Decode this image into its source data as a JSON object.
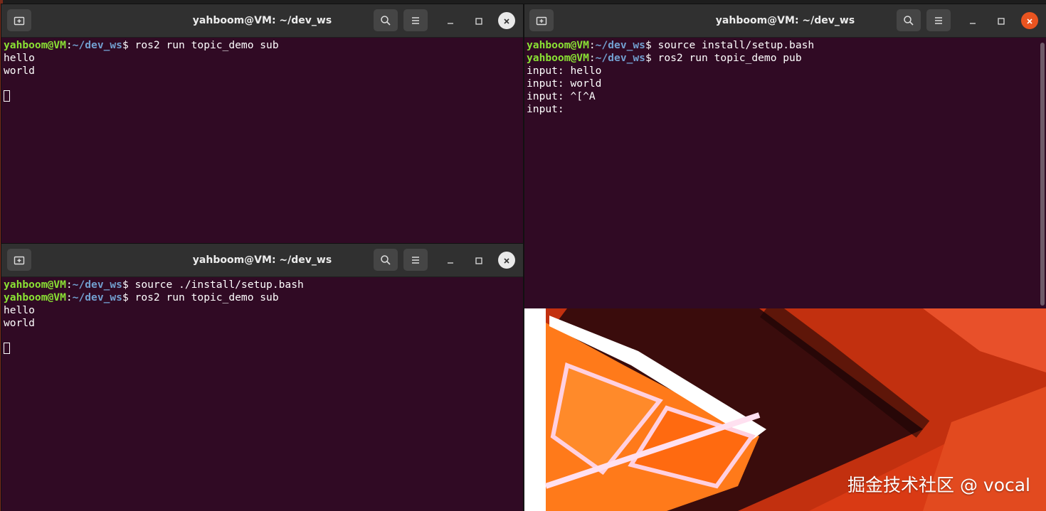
{
  "windows": [
    {
      "id": "top-left",
      "title": "yahboom@VM: ~/dev_ws",
      "lines": [
        {
          "user": "yahboom@VM",
          "sep": ":",
          "path": "~/dev_ws",
          "cmd": "$ ros2 run topic_demo sub"
        },
        {
          "text": "hello"
        },
        {
          "text": "world"
        },
        {
          "text": ""
        },
        {
          "cursor": true
        }
      ]
    },
    {
      "id": "right",
      "title": "yahboom@VM: ~/dev_ws",
      "lines": [
        {
          "user": "yahboom@VM",
          "sep": ":",
          "path": "~/dev_ws",
          "cmd": "$ source install/setup.bash"
        },
        {
          "user": "yahboom@VM",
          "sep": ":",
          "path": "~/dev_ws",
          "cmd": "$ ros2 run topic_demo pub"
        },
        {
          "text": "input: hello"
        },
        {
          "text": "input: world"
        },
        {
          "text": "input: ^[^A"
        },
        {
          "text": "input: "
        }
      ]
    },
    {
      "id": "bottom-left",
      "title": "yahboom@VM: ~/dev_ws",
      "lines": [
        {
          "user": "yahboom@VM",
          "sep": ":",
          "path": "~/dev_ws",
          "cmd": "$ source ./install/setup.bash"
        },
        {
          "user": "yahboom@VM",
          "sep": ":",
          "path": "~/dev_ws",
          "cmd": "$ ros2 run topic_demo sub"
        },
        {
          "text": "hello"
        },
        {
          "text": "world"
        },
        {
          "text": ""
        },
        {
          "cursor": true
        }
      ]
    }
  ],
  "icons": {
    "new_tab": "new-tab-icon",
    "search": "search-icon",
    "menu": "hamburger-menu-icon",
    "minimize": "minimize-icon",
    "maximize": "maximize-icon",
    "close": "close-icon"
  },
  "colors": {
    "terminal_bg": "#300a24",
    "titlebar_bg": "#303030",
    "prompt_user": "#8ae234",
    "prompt_path": "#729fcf",
    "close_active": "#e95420"
  },
  "watermark": "掘金技术社区 @ vocal"
}
